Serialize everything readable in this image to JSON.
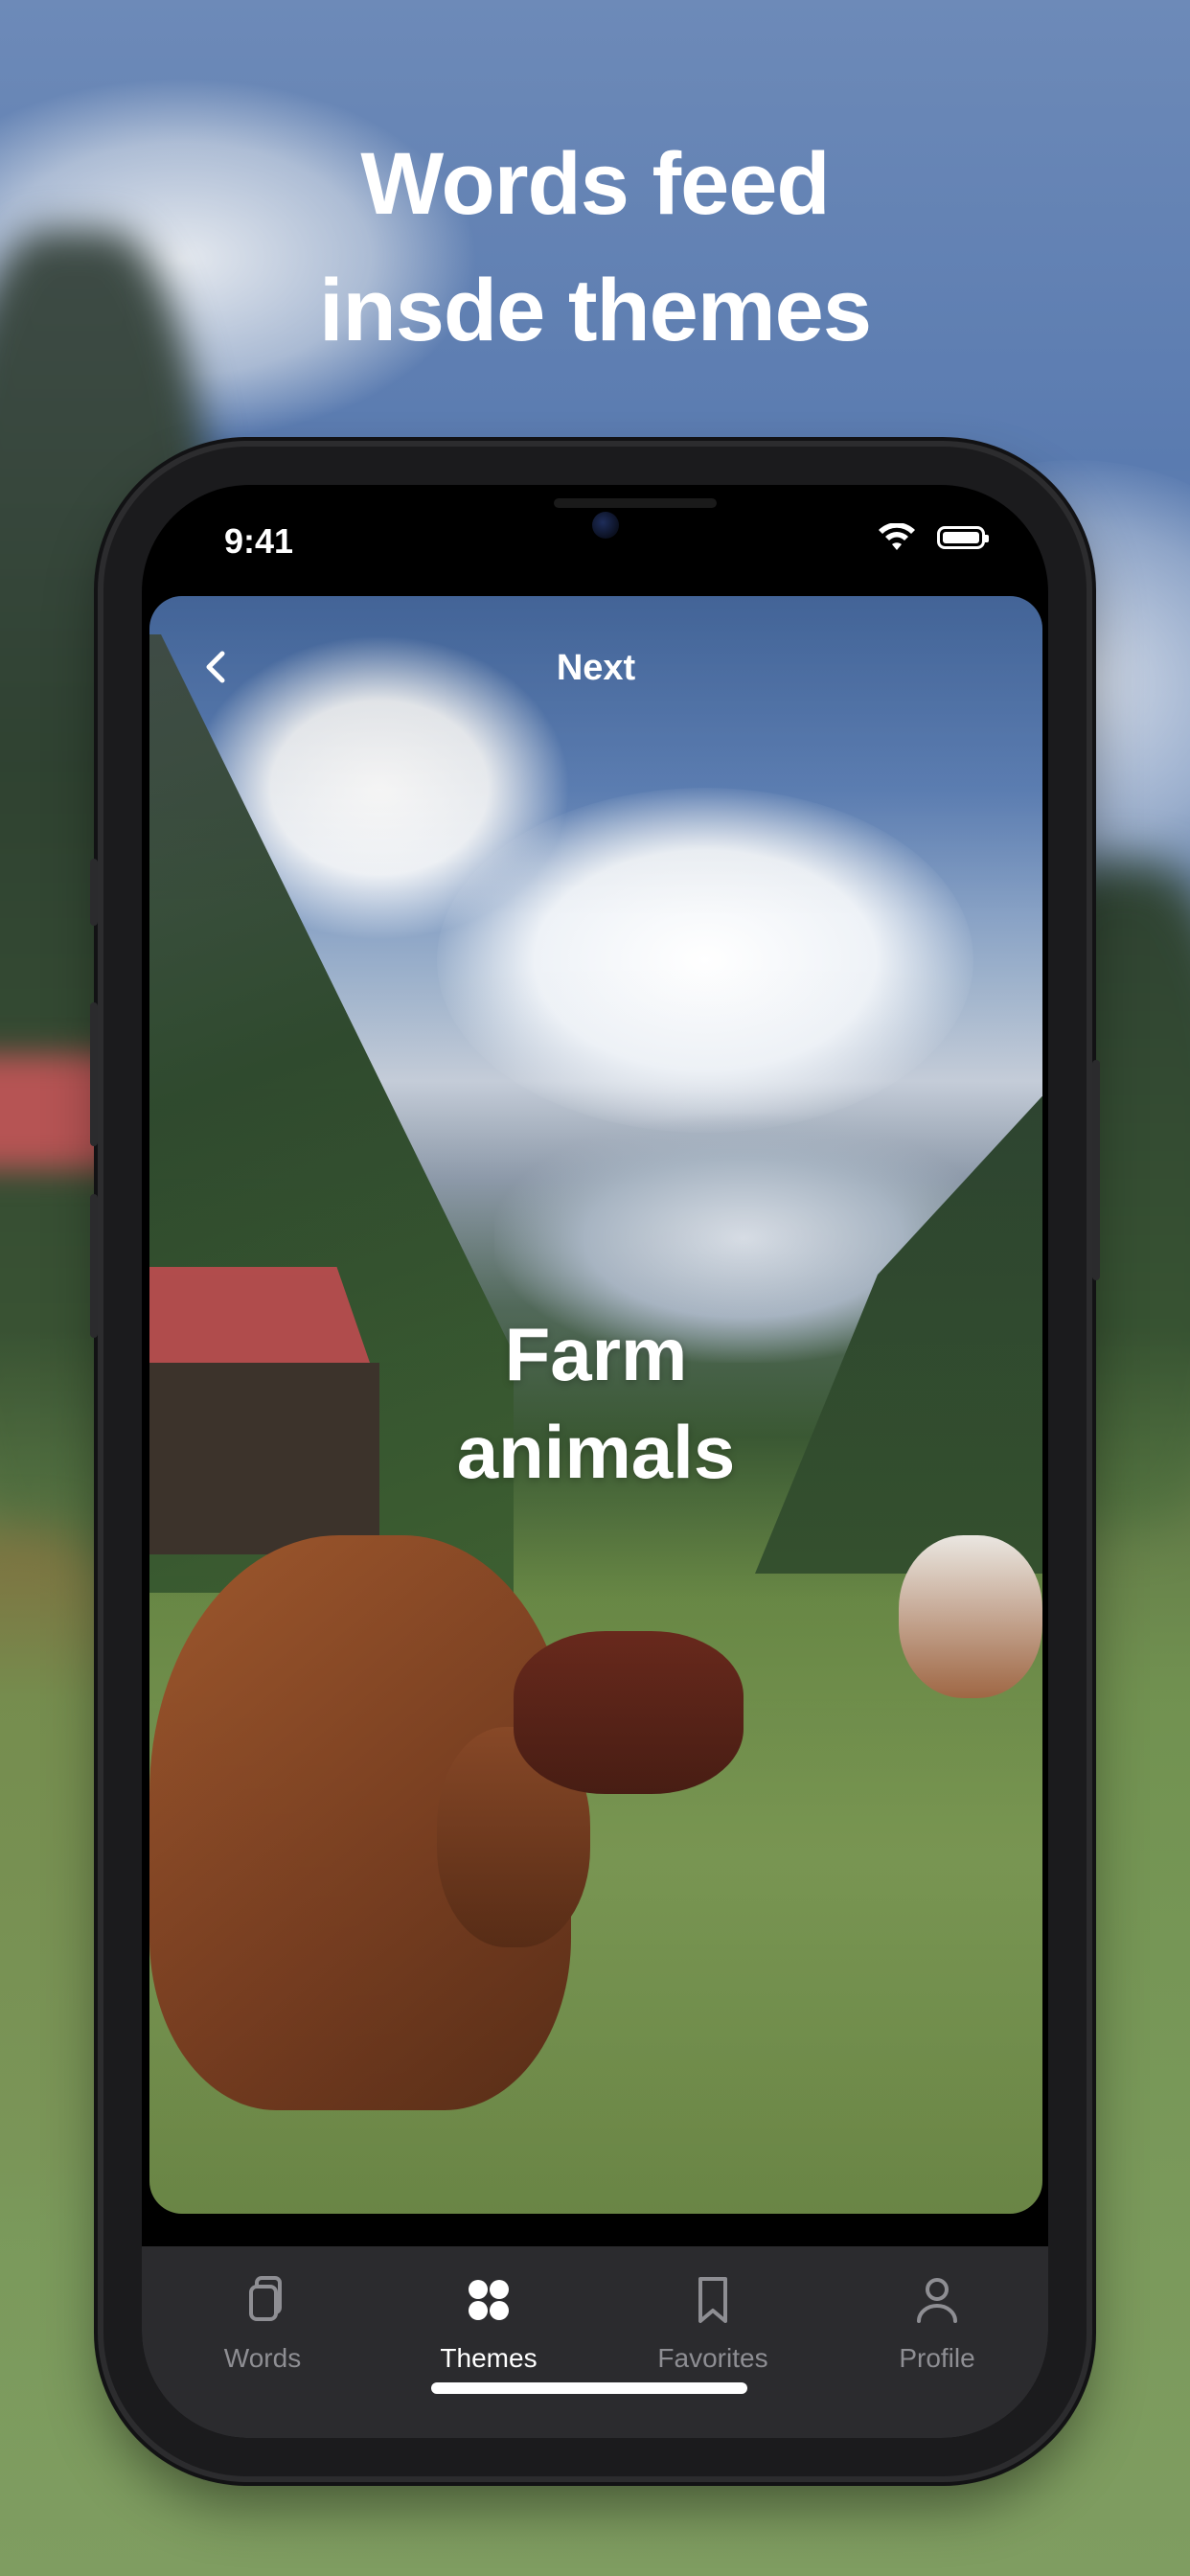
{
  "headline": {
    "line1": "Words feed",
    "line2": "insde themes"
  },
  "status_bar": {
    "time": "9:41"
  },
  "card": {
    "nav_title": "Next",
    "title_line1": "Farm",
    "title_line2": "animals"
  },
  "tabbar": {
    "tabs": [
      {
        "label": "Words",
        "icon": "cards-icon",
        "active": false
      },
      {
        "label": "Themes",
        "icon": "grid-dots-icon",
        "active": true
      },
      {
        "label": "Favorites",
        "icon": "bookmark-icon",
        "active": false
      },
      {
        "label": "Profile",
        "icon": "person-icon",
        "active": false
      }
    ]
  },
  "colors": {
    "active": "#ffffff",
    "inactive": "#8e8e93",
    "tabbar_bg": "#2b2b2e"
  }
}
